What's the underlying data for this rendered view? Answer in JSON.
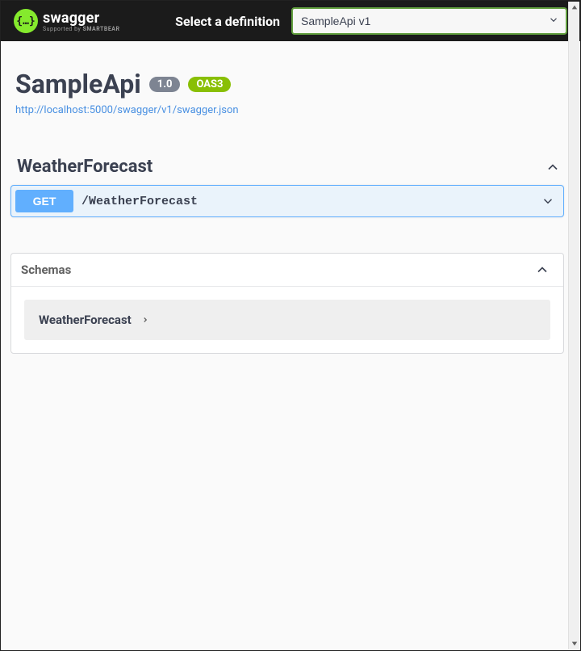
{
  "topbar": {
    "logo_text": "swagger",
    "supported_prefix": "Supported by ",
    "supported_brand": "SMARTBEAR",
    "select_label": "Select a definition",
    "definition_selected": "SampleApi v1"
  },
  "info": {
    "title": "SampleApi",
    "version_badge": "1.0",
    "oas_badge": "OAS3",
    "url": "http://localhost:5000/swagger/v1/swagger.json"
  },
  "tags": [
    {
      "name": "WeatherForecast",
      "operations": [
        {
          "method": "GET",
          "path": "/WeatherForecast"
        }
      ]
    }
  ],
  "schemas": {
    "title": "Schemas",
    "models": [
      {
        "name": "WeatherForecast"
      }
    ]
  },
  "colors": {
    "swagger_green": "#85ea2d",
    "get_blue": "#61affe",
    "oas_green": "#89bf04"
  }
}
